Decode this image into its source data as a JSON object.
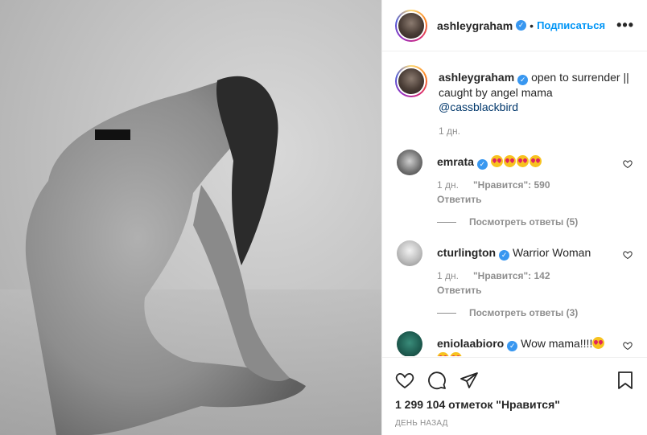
{
  "header": {
    "username": "ashleygraham",
    "separator": "•",
    "follow_label": "Подписаться",
    "more_label": "•••"
  },
  "caption": {
    "username": "ashleygraham",
    "text": "open to surrender || caught by angel mama",
    "mention": "@cassblackbird",
    "time": "1 дн."
  },
  "comments": [
    {
      "username": "emrata",
      "text": "",
      "emoji_count": 4,
      "time": "1 дн.",
      "likes": "\"Нравится\": 590",
      "reply_label": "Ответить",
      "view_replies": "Посмотреть ответы (5)"
    },
    {
      "username": "cturlington",
      "text": "Warrior Woman",
      "emoji_count": 0,
      "time": "1 дн.",
      "likes": "\"Нравится\": 142",
      "reply_label": "Ответить",
      "view_replies": "Посмотреть ответы (3)"
    },
    {
      "username": "eniolaabioro",
      "text": "Wow mama!!!!",
      "emoji_count": 3
    }
  ],
  "actions": {
    "likes_count": "1 299 104 отметок \"Нравится\"",
    "time_ago": "День назад"
  },
  "colors": {
    "accent": "#0095f6",
    "verified": "#3897f0",
    "muted": "#8e8e8e",
    "text": "#262626"
  }
}
